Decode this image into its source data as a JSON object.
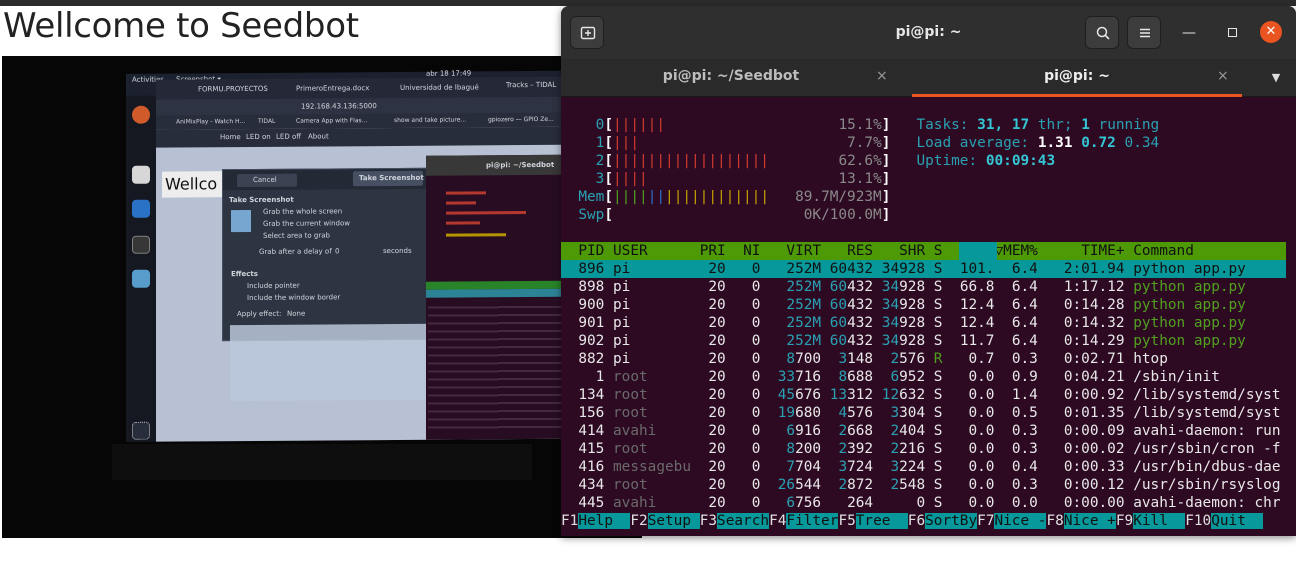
{
  "webpage": {
    "heading": "Wellcome to Seedbot"
  },
  "terminal": {
    "title": "pi@pi: ~",
    "tabs": [
      {
        "label": "pi@pi: ~/Seedbot",
        "active": false
      },
      {
        "label": "pi@pi: ~",
        "active": true
      }
    ],
    "close_glyph": "×"
  },
  "htop": {
    "cpus": [
      {
        "id": "0",
        "bars": "||||||",
        "pct": "15.1%"
      },
      {
        "id": "1",
        "bars": "|||",
        "pct": "7.7%"
      },
      {
        "id": "2",
        "bars": "||||||||||||||||||",
        "pct": "62.6%"
      },
      {
        "id": "3",
        "bars": "||||",
        "pct": "13.1%"
      }
    ],
    "mem": {
      "label": "Mem",
      "bars": "||||||||||||||||||",
      "value": "89.7M/923M"
    },
    "swp": {
      "label": "Swp",
      "bars": "",
      "value": "0K/100.0M"
    },
    "tasks": {
      "label": "Tasks:",
      "procs": "31",
      "thr": "17",
      "thr_label": "thr;",
      "running": "1",
      "running_label": "running"
    },
    "load": {
      "label": "Load average:",
      "v1": "1.31",
      "v5": "0.72",
      "v15": "0.34"
    },
    "uptime": {
      "label": "Uptime:",
      "value": "00:09:43"
    },
    "columns": [
      "PID",
      "USER",
      "PRI",
      "NI",
      "VIRT",
      "RES",
      "SHR",
      "S",
      "CPU%",
      "MEM%",
      "TIME+",
      "Command"
    ],
    "processes": [
      {
        "pid": "896",
        "user": "pi",
        "pri": "20",
        "ni": "0",
        "virt": "252M",
        "res": "60432",
        "shr": "34928",
        "s": "S",
        "cpu": "101.",
        "mem": "6.4",
        "time": "2:01.94",
        "cmd": "python app.py",
        "thread": false
      },
      {
        "pid": "898",
        "user": "pi",
        "pri": "20",
        "ni": "0",
        "virt": "252M",
        "res": "60432",
        "shr": "34928",
        "s": "S",
        "cpu": "66.8",
        "mem": "6.4",
        "time": "1:17.12",
        "cmd": "python app.py",
        "thread": true
      },
      {
        "pid": "900",
        "user": "pi",
        "pri": "20",
        "ni": "0",
        "virt": "252M",
        "res": "60432",
        "shr": "34928",
        "s": "S",
        "cpu": "12.4",
        "mem": "6.4",
        "time": "0:14.28",
        "cmd": "python app.py",
        "thread": true
      },
      {
        "pid": "901",
        "user": "pi",
        "pri": "20",
        "ni": "0",
        "virt": "252M",
        "res": "60432",
        "shr": "34928",
        "s": "S",
        "cpu": "12.4",
        "mem": "6.4",
        "time": "0:14.32",
        "cmd": "python app.py",
        "thread": true
      },
      {
        "pid": "902",
        "user": "pi",
        "pri": "20",
        "ni": "0",
        "virt": "252M",
        "res": "60432",
        "shr": "34928",
        "s": "S",
        "cpu": "11.7",
        "mem": "6.4",
        "time": "0:14.29",
        "cmd": "python app.py",
        "thread": true
      },
      {
        "pid": "882",
        "user": "pi",
        "pri": "20",
        "ni": "0",
        "virt": "8700",
        "res": "3148",
        "shr": "2576",
        "s": "R",
        "cpu": "0.7",
        "mem": "0.3",
        "time": "0:02.71",
        "cmd": "htop",
        "thread": false
      },
      {
        "pid": "1",
        "user": "root",
        "pri": "20",
        "ni": "0",
        "virt": "33716",
        "res": "8688",
        "shr": "6952",
        "s": "S",
        "cpu": "0.0",
        "mem": "0.9",
        "time": "0:04.21",
        "cmd": "/sbin/init",
        "thread": false
      },
      {
        "pid": "134",
        "user": "root",
        "pri": "20",
        "ni": "0",
        "virt": "45676",
        "res": "13312",
        "shr": "12632",
        "s": "S",
        "cpu": "0.0",
        "mem": "1.4",
        "time": "0:00.92",
        "cmd": "/lib/systemd/syst",
        "thread": false
      },
      {
        "pid": "156",
        "user": "root",
        "pri": "20",
        "ni": "0",
        "virt": "19680",
        "res": "4576",
        "shr": "3304",
        "s": "S",
        "cpu": "0.0",
        "mem": "0.5",
        "time": "0:01.35",
        "cmd": "/lib/systemd/syst",
        "thread": false
      },
      {
        "pid": "414",
        "user": "avahi",
        "pri": "20",
        "ni": "0",
        "virt": "6916",
        "res": "2668",
        "shr": "2404",
        "s": "S",
        "cpu": "0.0",
        "mem": "0.3",
        "time": "0:00.09",
        "cmd": "avahi-daemon: run",
        "thread": false
      },
      {
        "pid": "415",
        "user": "root",
        "pri": "20",
        "ni": "0",
        "virt": "8200",
        "res": "2392",
        "shr": "2216",
        "s": "S",
        "cpu": "0.0",
        "mem": "0.3",
        "time": "0:00.02",
        "cmd": "/usr/sbin/cron -f",
        "thread": false
      },
      {
        "pid": "416",
        "user": "messagebu",
        "pri": "20",
        "ni": "0",
        "virt": "7704",
        "res": "3724",
        "shr": "3224",
        "s": "S",
        "cpu": "0.0",
        "mem": "0.4",
        "time": "0:00.33",
        "cmd": "/usr/bin/dbus-dae",
        "thread": false
      },
      {
        "pid": "434",
        "user": "root",
        "pri": "20",
        "ni": "0",
        "virt": "26544",
        "res": "2872",
        "shr": "2548",
        "s": "S",
        "cpu": "0.0",
        "mem": "0.3",
        "time": "0:00.12",
        "cmd": "/usr/sbin/rsyslog",
        "thread": false
      },
      {
        "pid": "445",
        "user": "avahi",
        "pri": "20",
        "ni": "0",
        "virt": "6756",
        "res": "264",
        "shr": "0",
        "s": "S",
        "cpu": "0.0",
        "mem": "0.0",
        "time": "0:00.00",
        "cmd": "avahi-daemon: chr",
        "thread": false
      }
    ],
    "fkeys": [
      {
        "key": "F1",
        "label": "Help  "
      },
      {
        "key": "F2",
        "label": "Setup "
      },
      {
        "key": "F3",
        "label": "Search"
      },
      {
        "key": "F4",
        "label": "Filter"
      },
      {
        "key": "F5",
        "label": "Tree  "
      },
      {
        "key": "F6",
        "label": "SortBy"
      },
      {
        "key": "F7",
        "label": "Nice -"
      },
      {
        "key": "F8",
        "label": "Nice +"
      },
      {
        "key": "F9",
        "label": "Kill  "
      },
      {
        "key": "F10",
        "label": "Quit  "
      }
    ]
  },
  "photo": {
    "topbar_left": "Activities",
    "topbar_app": "Screenshot ▾",
    "topbar_clock": "abr 18  17:49",
    "tabs": [
      "FORMU.PROYECTOS",
      "PrimeroEntrega.docx",
      "Universidad de Ibagué",
      "Tracks – TIDAL"
    ],
    "address": "192.168.43.136:5000",
    "bookmarks": [
      "AniMixPlay - Watch H...",
      "TIDAL",
      "Camera App with Flas...",
      "show and take picture...",
      "gpiozero — GPIO Ze..."
    ],
    "nav": [
      "Home",
      "LED on",
      "LED off",
      "About"
    ],
    "page_heading": "Wellco",
    "dialog": {
      "cancel": "Cancel",
      "take": "Take Screenshot",
      "section": "Take Screenshot",
      "options": [
        "Grab the whole screen",
        "Grab the current window",
        "Select area to grab"
      ],
      "delay_label": "Grab after a delay of",
      "delay_value": "0",
      "delay_unit": "seconds",
      "effects": "Effects",
      "include_pointer": "Include pointer",
      "include_border": "Include the window border",
      "apply_label": "Apply effect:",
      "apply_value": "None"
    },
    "terminal_title": "pi@pi: ~/Seedbot"
  }
}
